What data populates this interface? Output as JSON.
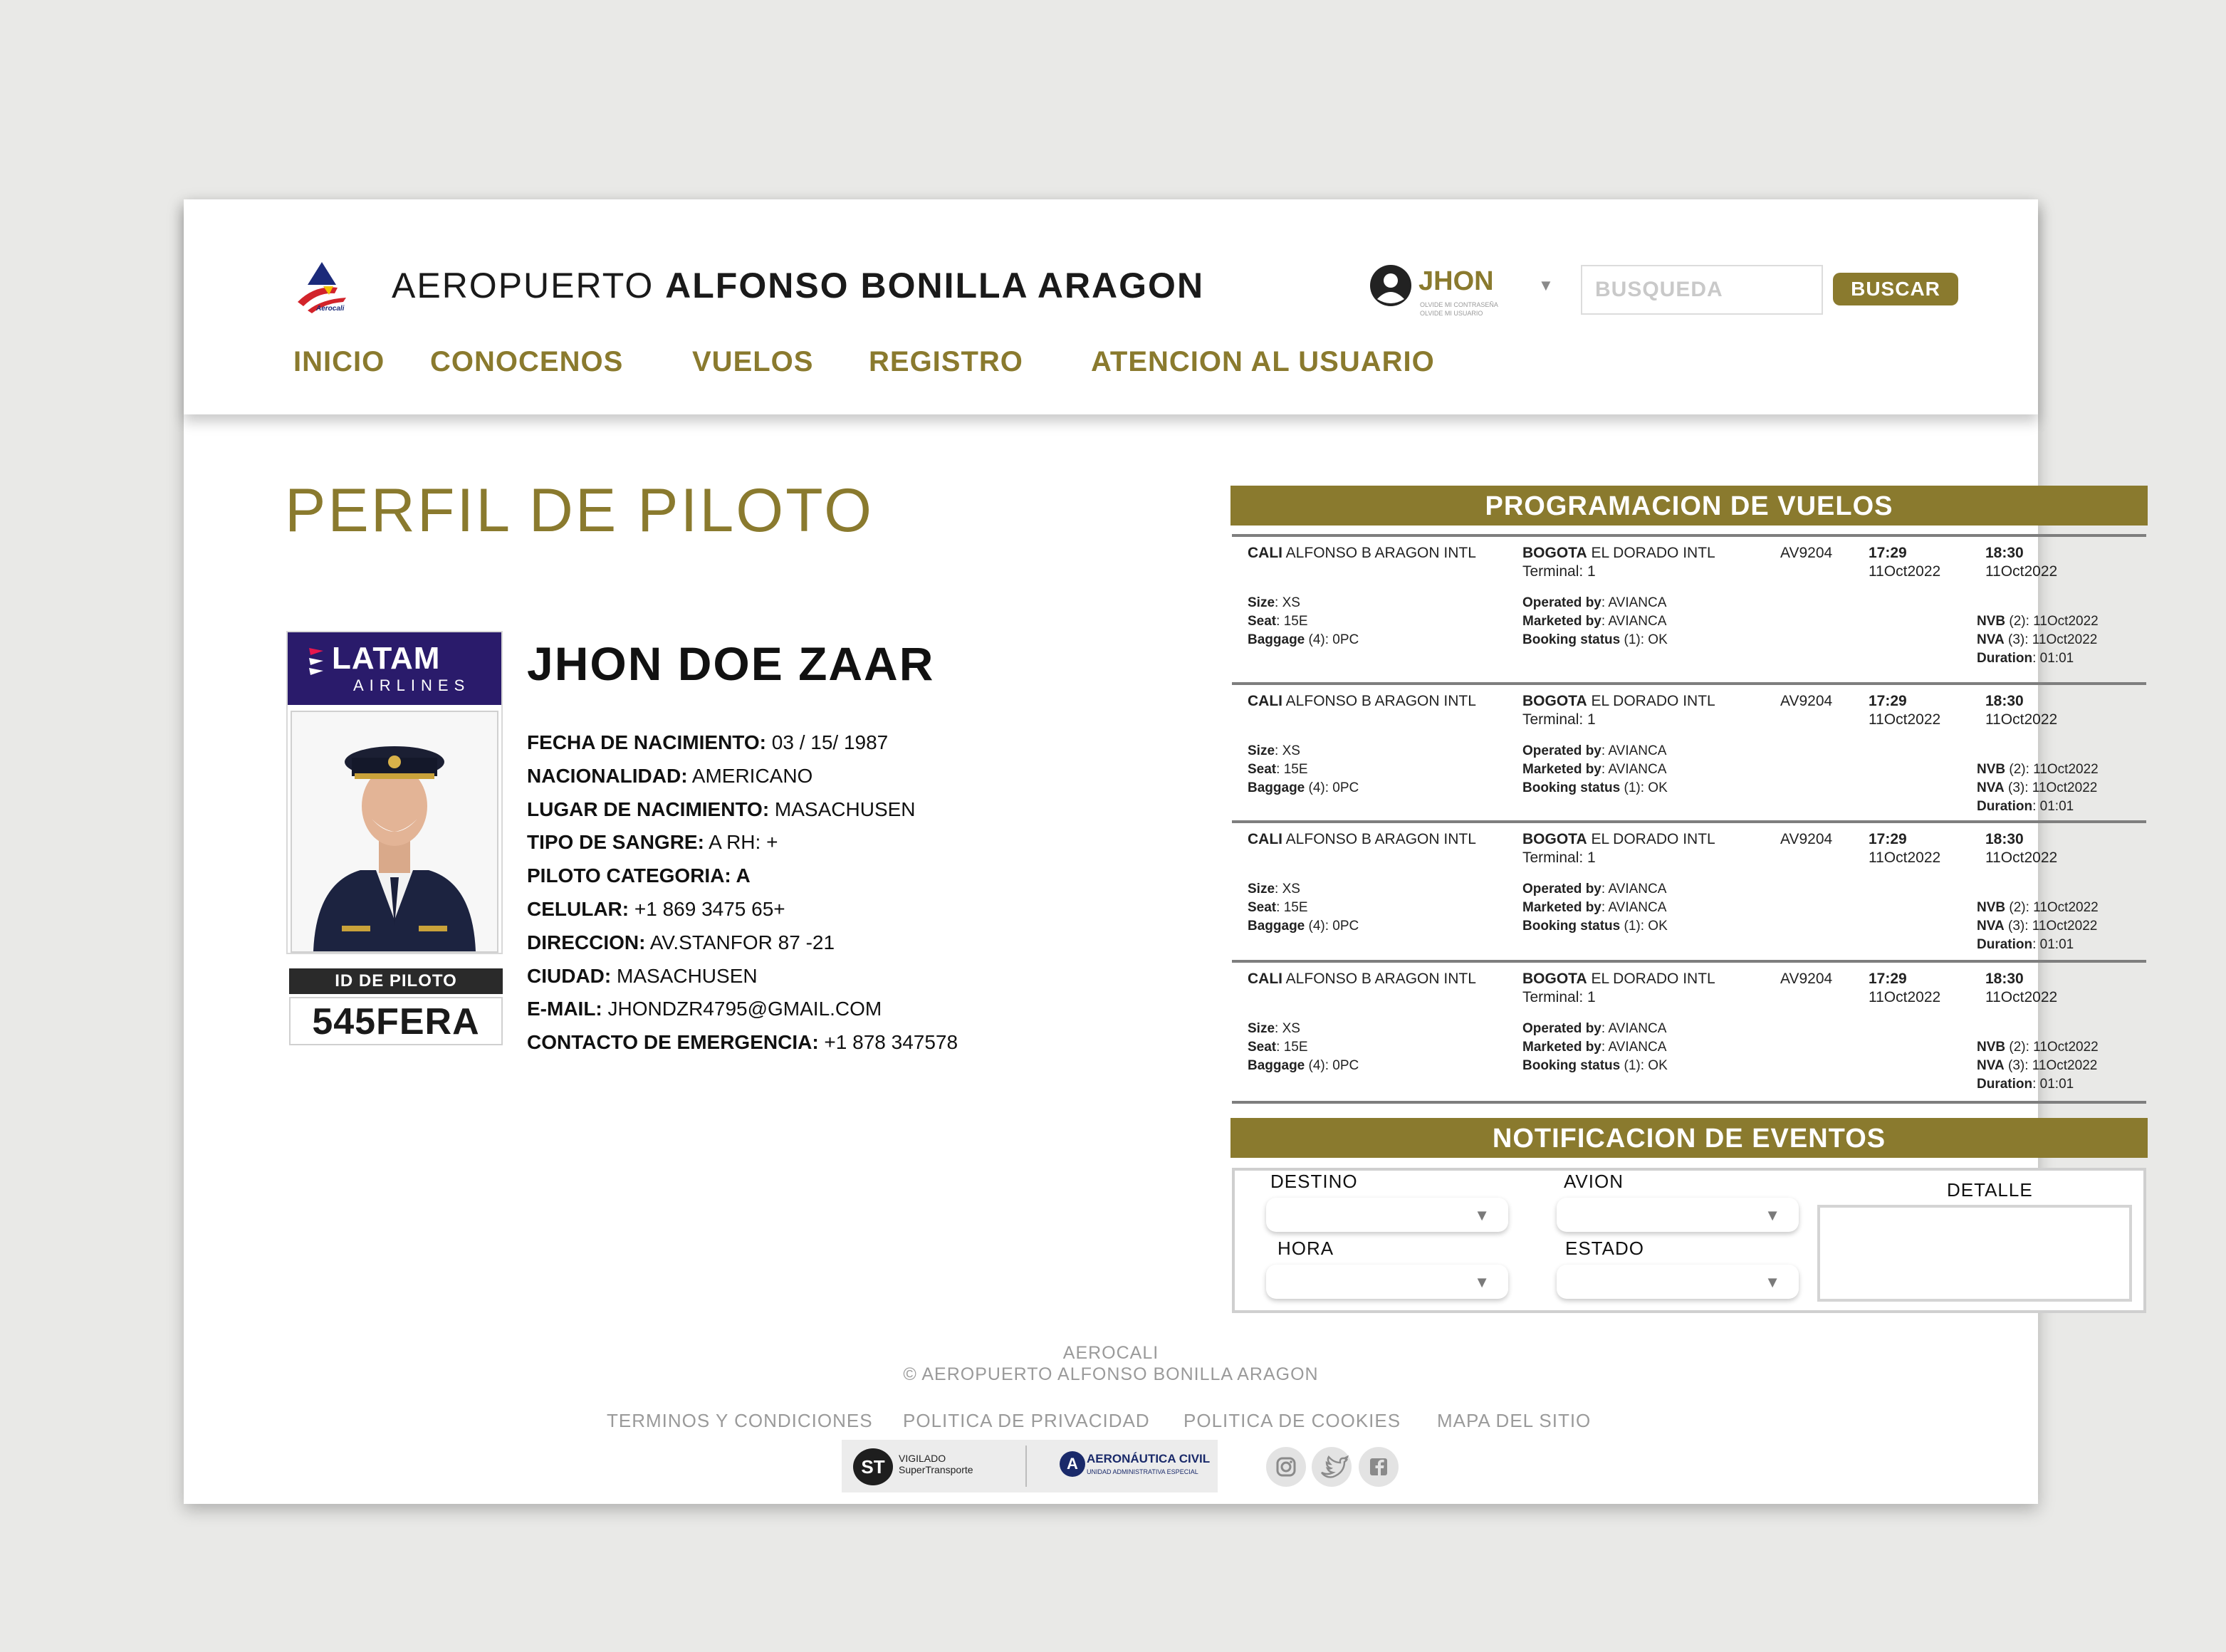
{
  "header": {
    "logo_text": "Aerocali",
    "title_light": "AEROPUERTO ",
    "title_bold": "ALFONSO BONILLA ARAGON",
    "user": {
      "name": "JHON",
      "link1": "OLVIDE MI CONTRASEÑA",
      "link2": "OLVIDE MI USUARIO"
    },
    "search": {
      "placeholder": "BUSQUEDA",
      "button": "BUSCAR"
    },
    "nav": [
      "INICIO",
      "CONOCENOS",
      "VUELOS",
      "REGISTRO",
      "ATENCION AL USUARIO"
    ]
  },
  "profile": {
    "page_title": "PERFIL DE PILOTO",
    "airline_name": "LATAM",
    "airline_sub": "AIRLINES",
    "id_label": "ID DE PILOTO",
    "id_value": "545FERA",
    "name": "JHON DOE ZAAR",
    "fields": [
      {
        "label": "FECHA DE NACIMIENTO:",
        "value": " 03 / 15/ 1987"
      },
      {
        "label": "NACIONALIDAD:",
        "value": " AMERICANO"
      },
      {
        "label": "LUGAR DE NACIMIENTO:",
        "value": " MASACHUSEN"
      },
      {
        "label": "TIPO DE SANGRE:",
        "value": " A RH: +"
      },
      {
        "label": "PILOTO CATEGORIA: A",
        "value": ""
      },
      {
        "label": "CELULAR:",
        "value": " +1 869 3475 65+"
      },
      {
        "label": "DIRECCION:",
        "value": " AV.STANFOR 87 -21"
      },
      {
        "label": "CIUDAD:",
        "value": " MASACHUSEN"
      },
      {
        "label": "E-MAIL:",
        "value": " JHONDZR4795@GMAIL.COM"
      },
      {
        "label": "CONTACTO DE EMERGENCIA:",
        "value": " +1 878 347578"
      }
    ]
  },
  "flights": {
    "title": "PROGRAMACION DE VUELOS",
    "items": [
      {
        "origin_code": "CALI",
        "origin": " ALFONSO B ARAGON INTL",
        "dest_code": "BOGOTA",
        "dest": " EL DORADO INTL",
        "terminal": "Terminal:  1",
        "flight": "AV9204",
        "dep_time": "17:29",
        "dep_date": "11Oct2022",
        "arr_time": "18:30",
        "arr_date": "11Oct2022",
        "size_label": "Size",
        "size": ": XS",
        "seat_label": "Seat",
        "seat": ": 15E",
        "baggage_label": "Baggage",
        "baggage": " (4): 0PC",
        "operated_label": "Operated by",
        "operated": ": AVIANCA",
        "marketed_label": "Marketed by",
        "marketed": ": AVIANCA",
        "booking_label": "Booking status",
        "booking": " (1): OK",
        "nvb_label": "NVB",
        "nvb": " (2): 11Oct2022",
        "nva_label": "NVA",
        "nva": " (3): 11Oct2022",
        "duration_label": "Duration",
        "duration": ": 01:01"
      },
      {
        "origin_code": "CALI",
        "origin": " ALFONSO B ARAGON INTL",
        "dest_code": "BOGOTA",
        "dest": " EL DORADO INTL",
        "terminal": "Terminal:  1",
        "flight": "AV9204",
        "dep_time": "17:29",
        "dep_date": "11Oct2022",
        "arr_time": "18:30",
        "arr_date": "11Oct2022",
        "size_label": "Size",
        "size": ": XS",
        "seat_label": "Seat",
        "seat": ": 15E",
        "baggage_label": "Baggage",
        "baggage": " (4): 0PC",
        "operated_label": "Operated by",
        "operated": ": AVIANCA",
        "marketed_label": "Marketed by",
        "marketed": ": AVIANCA",
        "booking_label": "Booking status",
        "booking": " (1): OK",
        "nvb_label": "NVB",
        "nvb": " (2): 11Oct2022",
        "nva_label": "NVA",
        "nva": " (3): 11Oct2022",
        "duration_label": "Duration",
        "duration": ": 01:01"
      },
      {
        "origin_code": "CALI",
        "origin": " ALFONSO B ARAGON INTL",
        "dest_code": "BOGOTA",
        "dest": " EL DORADO INTL",
        "terminal": "Terminal:  1",
        "flight": "AV9204",
        "dep_time": "17:29",
        "dep_date": "11Oct2022",
        "arr_time": "18:30",
        "arr_date": "11Oct2022",
        "size_label": "Size",
        "size": ": XS",
        "seat_label": "Seat",
        "seat": ": 15E",
        "baggage_label": "Baggage",
        "baggage": " (4): 0PC",
        "operated_label": "Operated by",
        "operated": ": AVIANCA",
        "marketed_label": "Marketed by",
        "marketed": ": AVIANCA",
        "booking_label": "Booking status",
        "booking": " (1): OK",
        "nvb_label": "NVB",
        "nvb": " (2): 11Oct2022",
        "nva_label": "NVA",
        "nva": " (3): 11Oct2022",
        "duration_label": "Duration",
        "duration": ": 01:01"
      },
      {
        "origin_code": "CALI",
        "origin": " ALFONSO B ARAGON INTL",
        "dest_code": "BOGOTA",
        "dest": " EL DORADO INTL",
        "terminal": "Terminal:  1",
        "flight": "AV9204",
        "dep_time": "17:29",
        "dep_date": "11Oct2022",
        "arr_time": "18:30",
        "arr_date": "11Oct2022",
        "size_label": "Size",
        "size": ": XS",
        "seat_label": "Seat",
        "seat": ": 15E",
        "baggage_label": "Baggage",
        "baggage": " (4): 0PC",
        "operated_label": "Operated by",
        "operated": ": AVIANCA",
        "marketed_label": "Marketed by",
        "marketed": ": AVIANCA",
        "booking_label": "Booking status",
        "booking": " (1): OK",
        "nvb_label": "NVB",
        "nvb": " (2): 11Oct2022",
        "nva_label": "NVA",
        "nva": " (3): 11Oct2022",
        "duration_label": "Duration",
        "duration": ": 01:01"
      }
    ]
  },
  "events": {
    "title": "NOTIFICACION DE EVENTOS",
    "destino": "DESTINO",
    "avion": "AVION",
    "hora": "HORA",
    "estado": "ESTADO",
    "detalle": "DETALLE"
  },
  "footer": {
    "brand": "AEROCALI",
    "copyright": "© AEROPUERTO ALFONSO BONILLA ARAGON",
    "links": [
      "TERMINOS Y CONDICIONES",
      "POLITICA DE PRIVACIDAD",
      "POLITICA DE COOKIES",
      "MAPA DEL SITIO"
    ],
    "seal1_mark": "ST",
    "seal1_line1": "VIGILADO",
    "seal1_line2": "SuperTransporte",
    "seal2_mark": "A",
    "seal2_line1": "AERONÁUTICA CIVIL",
    "seal2_line2": "UNIDAD ADMINISTRATIVA ESPECIAL",
    "social": [
      "instagram-icon",
      "twitter-icon",
      "facebook-icon"
    ]
  },
  "colors": {
    "accent": "#8a7a2e",
    "airline": "#2a1b6b",
    "background": "#e9e9e7"
  }
}
